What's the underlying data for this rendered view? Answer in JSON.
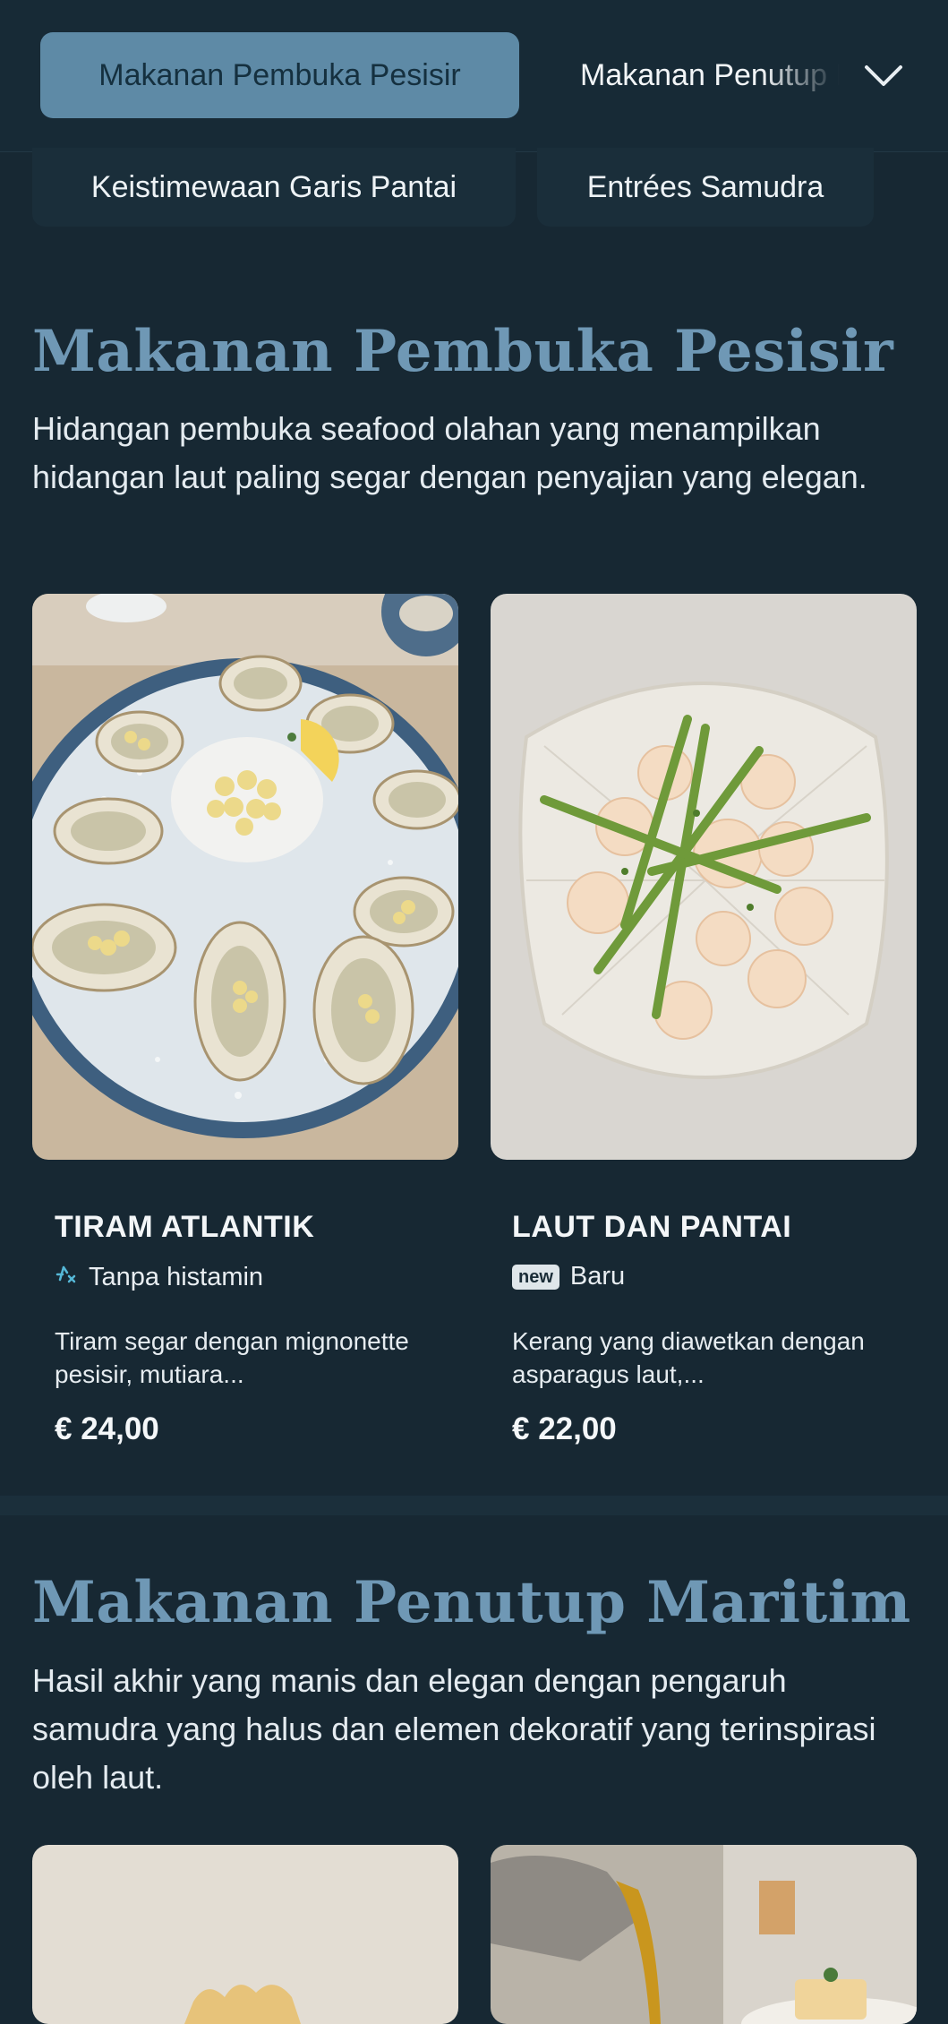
{
  "tabs": {
    "active": "Makanan Pembuka Pesisir",
    "next": "Makanan Penutup Maritim",
    "row2": [
      "Keistimewaan Garis Pantai",
      "Entrées Samudra"
    ]
  },
  "sections": [
    {
      "title": "Makanan Pembuka Pesisir",
      "description": "Hidangan pembuka seafood olahan yang menampilkan hidangan laut paling segar dengan penyajian yang elegan.",
      "items": [
        {
          "name": "TIRAM ATLANTIK",
          "tag_icon": "histamine-free-icon",
          "tag": "Tanpa histamin",
          "description": "Tiram segar dengan mignonette pesisir, mutiara...",
          "price": "€ 24,00"
        },
        {
          "name": "LAUT DAN PANTAI",
          "tag_badge": "new",
          "tag": "Baru",
          "description": "Kerang yang diawetkan dengan asparagus laut,...",
          "price": "€ 22,00"
        }
      ]
    },
    {
      "title": "Makanan Penutup Maritim",
      "description": "Hasil akhir yang manis dan elegan dengan pengaruh samudra yang halus dan elemen dekoratif yang terinspirasi oleh laut."
    }
  ],
  "colors": {
    "background": "#172833",
    "accent": "#5e8aa6",
    "title": "#6f98b5"
  }
}
